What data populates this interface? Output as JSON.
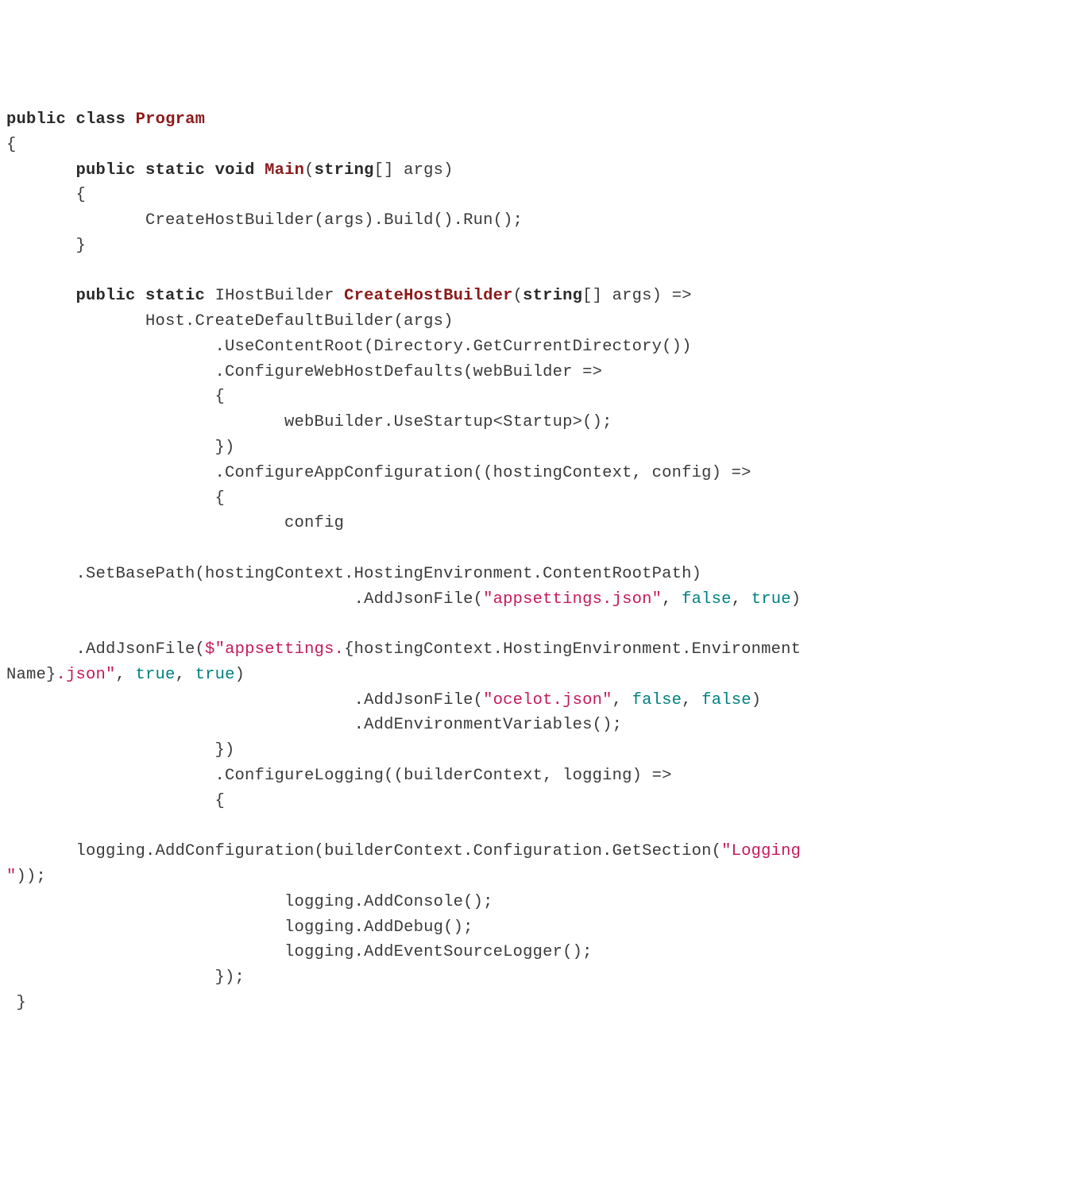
{
  "tokens": {
    "t0": "public",
    "t1": " ",
    "t2": "class",
    "t3": " ",
    "t4": "Program",
    "t5": "\n{\n       ",
    "t6": "public",
    "t7": " ",
    "t8": "static",
    "t9": " ",
    "t10": "void",
    "t11": " ",
    "t12": "Main",
    "t13": "(",
    "t14": "string",
    "t15": "[] args)\n       {\n              CreateHostBuilder(args).Build().Run();\n       }\n\n       ",
    "t16": "public",
    "t17": " ",
    "t18": "static",
    "t19": " IHostBuilder ",
    "t20": "CreateHostBuilder",
    "t21": "(",
    "t22": "string",
    "t23": "[] args) =>\n              Host.CreateDefaultBuilder(args)\n                     .UseContentRoot(Directory.GetCurrentDirectory())\n                     .ConfigureWebHostDefaults(webBuilder =>\n                     {\n                            webBuilder.UseStartup<Startup>();\n                     })\n                     .ConfigureAppConfiguration((hostingContext, config) =>\n                     {\n                            config\n\n       .SetBasePath(hostingContext.HostingEnvironment.ContentRootPath)\n                                   .AddJsonFile(",
    "t24": "\"appsettings.json\"",
    "t25": ", ",
    "t26": "false",
    "t27": ", ",
    "t28": "true",
    "t29": ")\n\n       .AddJsonFile(",
    "t30": "$",
    "t31": "\"appsettings.",
    "t32": "{hostingContext.HostingEnvironment.Environment\nName}",
    "t33": ".json\"",
    "t34": ", ",
    "t35": "true",
    "t36": ", ",
    "t37": "true",
    "t38": ")\n                                   .AddJsonFile(",
    "t39": "\"ocelot.json\"",
    "t40": ", ",
    "t41": "false",
    "t42": ", ",
    "t43": "false",
    "t44": ")\n                                   .AddEnvironmentVariables();\n                     })\n                     .ConfigureLogging((builderContext, logging) =>\n                     {\n\n       logging.AddConfiguration(builderContext.Configuration.GetSection(",
    "t45": "\"Logging\n\"",
    "t46": "));\n                            logging.AddConsole();\n                            logging.AddDebug();\n                            logging.AddEventSourceLogger();\n                     });\n }"
  }
}
